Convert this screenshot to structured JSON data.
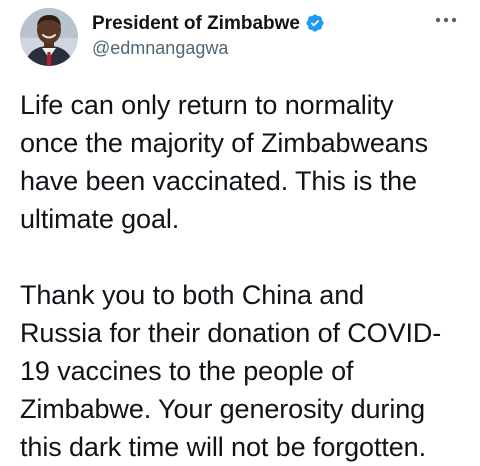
{
  "author": {
    "display_name": "President of Zimbabwe",
    "handle": "@edmnangagwa",
    "verified_icon": "verified-badge-icon",
    "avatar": "profile-photo"
  },
  "menu": {
    "icon": "more-dots-icon"
  },
  "colors": {
    "verified_blue": "#1d9bf0",
    "text_primary": "#0f1419",
    "text_secondary": "#536471"
  },
  "tweet": {
    "paragraphs": [
      {
        "lines": [
          "Life can only return to normality",
          "once the majority of Zimbabweans",
          "have been vaccinated. This is the",
          "ultimate goal."
        ]
      },
      {
        "lines": [
          "Thank you to both China and",
          "Russia for their donation of COVID-",
          "19 vaccines to the people of",
          "Zimbabwe. Your generosity during",
          "this dark time will not be forgotten."
        ]
      }
    ]
  }
}
